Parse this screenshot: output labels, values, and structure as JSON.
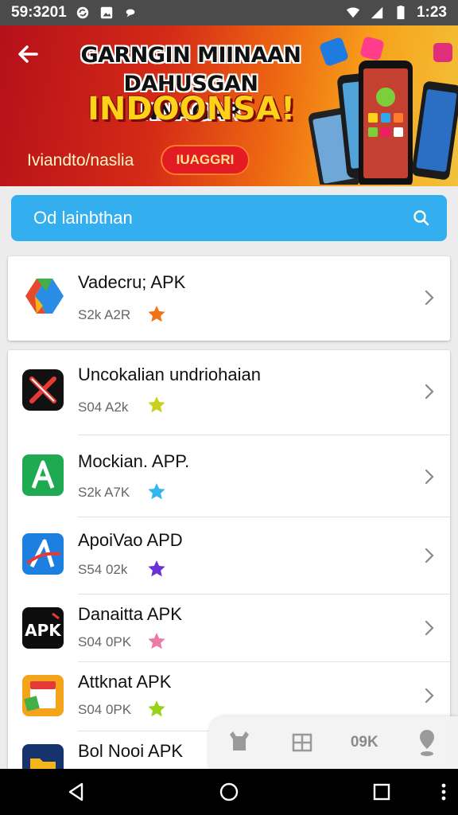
{
  "status_bar": {
    "time_left": "59:3201",
    "time_right": "1:23",
    "icons": [
      "sync-icon",
      "image-icon",
      "chat-icon",
      "wifi-icon",
      "signal-icon",
      "battery-icon"
    ]
  },
  "banner": {
    "title_line1": "GARNGIN MIINAAN",
    "title_line2": "DAHUSGAN NNAGAR",
    "headline": "INDOONSA!",
    "subtitle": "Iviandto/naslia",
    "badge": "IUAGGRI",
    "colors": {
      "start": "#b5101a",
      "end": "#f2c23a",
      "headline": "#ffd21a",
      "badge": "#e31b23"
    }
  },
  "search": {
    "placeholder": "Od lainbthan",
    "color": "#33aeee"
  },
  "featured": {
    "name": "Vadecru; APK",
    "meta": "S2k A2R",
    "star_color": "#f07416",
    "icon": "app-logo-gradient-icon"
  },
  "apps": [
    {
      "name": "Uncokalian undriohaian",
      "meta": "S04 A2k",
      "star_color": "#c9d21a",
      "icon": "x-logo-icon"
    },
    {
      "name": "Mockian. APP.",
      "meta": "S2k A7K",
      "star_color": "#35b5ee",
      "icon": "a-green-logo-icon"
    },
    {
      "name": "ApoiVao APD",
      "meta": "S54 02k",
      "star_color": "#6a2fd6",
      "icon": "a-blue-logo-icon"
    },
    {
      "name": "Danaitta APK",
      "meta": "S04 0PK",
      "star_color": "#ea7aa6",
      "icon": "apk-logo-icon"
    },
    {
      "name": "Attknat APK",
      "meta": "S04 0PK",
      "star_color": "#9ad21a",
      "icon": "gift-box-icon"
    },
    {
      "name": "Bol Nooi APK",
      "meta": "",
      "star_color": "#f2b61a",
      "icon": "folder-logo-icon"
    }
  ],
  "tab_bar": {
    "label_3": "09K"
  },
  "nav": [
    "back-icon",
    "home-icon",
    "recents-icon"
  ]
}
